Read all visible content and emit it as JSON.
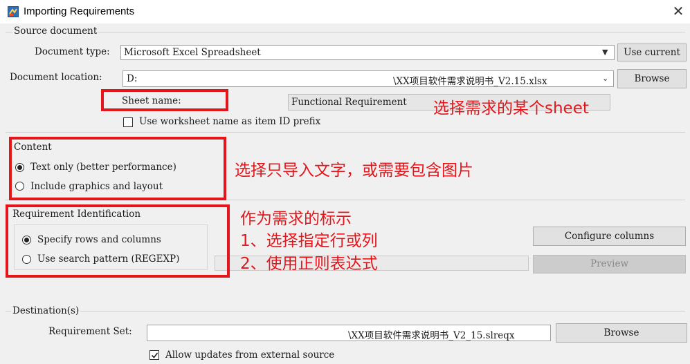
{
  "window": {
    "title": "Importing Requirements",
    "close_glyph": "✕"
  },
  "source": {
    "group_label": "Source document",
    "doc_type_label": "Document type:",
    "doc_type_value": "Microsoft Excel Spreadsheet",
    "use_current_label": "Use current",
    "doc_location_label": "Document location:",
    "doc_location_prefix": "D:",
    "doc_location_suffix": "\\XX项目软件需求说明书_V2.15.xlsx",
    "browse_label": "Browse",
    "sheet_name_label": "Sheet name:",
    "sheet_name_value": "Functional Requirement",
    "prefix_checkbox_label": "Use worksheet name as item ID prefix",
    "prefix_checked": false
  },
  "content": {
    "group_label": "Content",
    "options": [
      {
        "label": "Text only (better performance)",
        "selected": true
      },
      {
        "label": "Include graphics and layout",
        "selected": false
      }
    ]
  },
  "identification": {
    "group_label": "Requirement Identification",
    "options": [
      {
        "label": "Specify rows and columns",
        "selected": true
      },
      {
        "label": "Use search pattern (REGEXP)",
        "selected": false
      }
    ],
    "configure_label": "Configure columns",
    "preview_label": "Preview"
  },
  "destination": {
    "group_label": "Destination(s)",
    "req_set_label": "Requirement Set:",
    "req_set_suffix": "\\XX项目软件需求说明书_V2_15.slreqx",
    "browse_label": "Browse",
    "allow_updates_label": "Allow updates from external source",
    "allow_updates_checked": true
  },
  "annotations": {
    "sheet": "选择需求的某个sheet",
    "content": "选择只导入文字，或需要包含图片",
    "ident_title": "作为需求的标示",
    "ident_1": "1、选择指定行或列",
    "ident_2": "2、使用正则表达式"
  },
  "colors": {
    "annotation_red": "#e4161b",
    "background": "#f0f0f0"
  },
  "icons": {
    "app": "simulink-app-icon",
    "dropdown": "chevron-down-icon"
  }
}
